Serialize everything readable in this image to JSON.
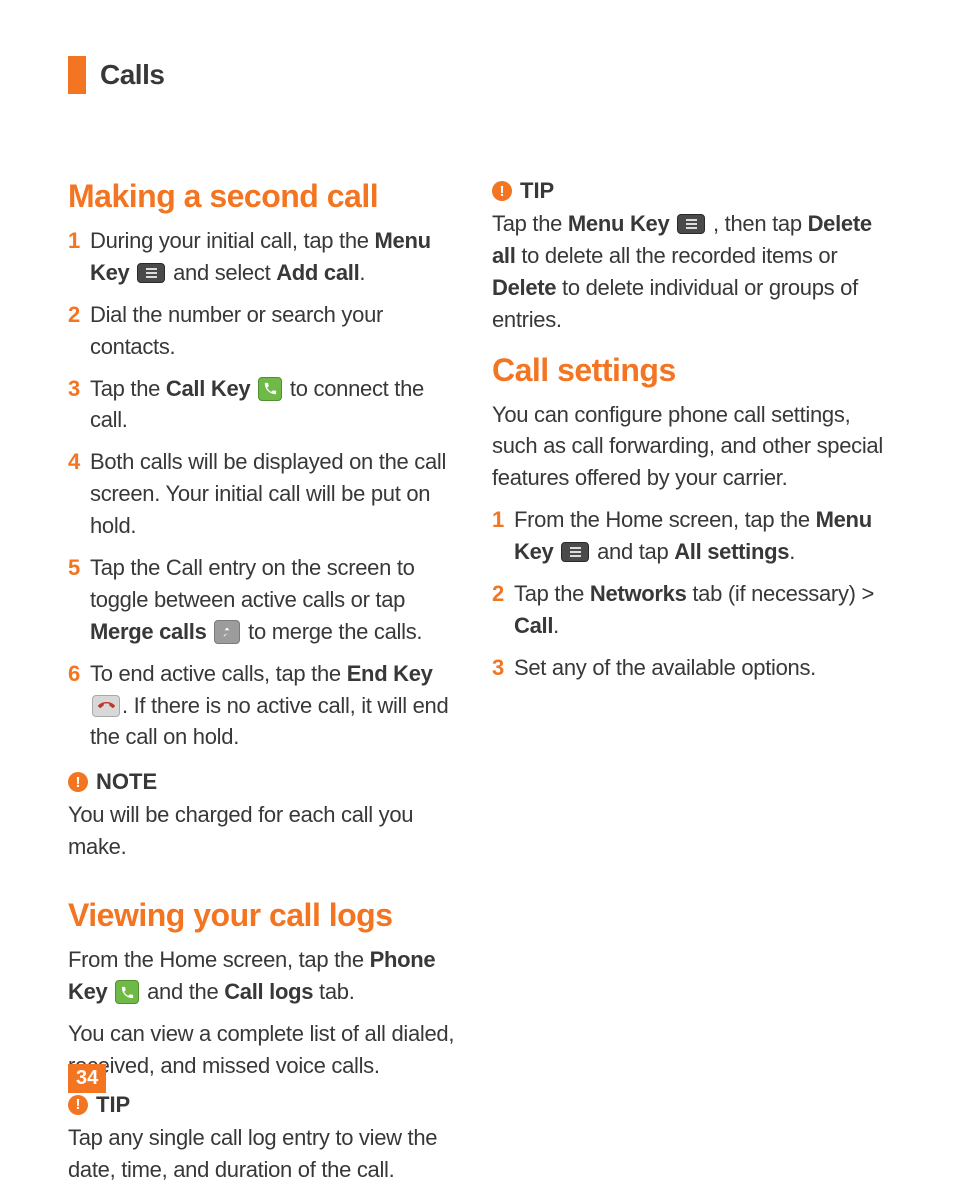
{
  "header": {
    "title": "Calls"
  },
  "page_number": "34",
  "left": {
    "h1": "Making a second call",
    "steps1": [
      {
        "n": "1",
        "parts": [
          "During your initial call, tap the ",
          "Menu Key",
          " ",
          "[menu]",
          " and select ",
          "Add call",
          "."
        ]
      },
      {
        "n": "2",
        "parts": [
          "Dial the number or search your contacts."
        ]
      },
      {
        "n": "3",
        "parts": [
          "Tap the ",
          "Call Key",
          " ",
          "[call]",
          " to connect the call."
        ]
      },
      {
        "n": "4",
        "parts": [
          "Both calls will be displayed on the call screen. Your initial call will be put on hold."
        ]
      },
      {
        "n": "5",
        "parts": [
          "Tap the Call entry on the screen to toggle between active calls or tap ",
          "Merge calls",
          " ",
          "[merge]",
          " to merge the calls."
        ]
      },
      {
        "n": "6",
        "parts": [
          "To end active calls, tap the ",
          "End Key",
          " ",
          "[end]",
          ". If there is no active call, it will end the call on hold."
        ]
      }
    ],
    "note_label": "NOTE",
    "note_body": "You will be charged for each call you make.",
    "h2": "Viewing your call logs",
    "para2_parts": [
      "From the Home screen, tap the ",
      "Phone Key",
      " ",
      "[call]",
      " and the ",
      "Call logs",
      " tab."
    ],
    "para2b": "You can view a complete list of all dialed, received, and missed voice calls.",
    "tip_label": "TIP",
    "tip_body": "Tap any single call log entry to view the date, time, and duration of the call."
  },
  "right": {
    "tip_label": "TIP",
    "tip_parts": [
      "Tap the ",
      "Menu Key",
      " ",
      "[menu]",
      " , then tap ",
      "Delete all",
      " to delete all the recorded items or ",
      "Delete",
      " to delete individual or groups of entries."
    ],
    "h1": "Call settings",
    "para1": "You can configure phone call settings, such as call forwarding,  and other special features offered by your carrier.",
    "steps": [
      {
        "n": "1",
        "parts": [
          "From the Home screen, tap the ",
          "Menu Key",
          " ",
          "[menu]",
          " and tap ",
          "All settings",
          "."
        ]
      },
      {
        "n": "2",
        "parts": [
          "Tap the ",
          "Networks",
          " tab (if necessary) > ",
          "Call",
          "."
        ]
      },
      {
        "n": "3",
        "parts": [
          "Set any of the available options."
        ]
      }
    ]
  }
}
